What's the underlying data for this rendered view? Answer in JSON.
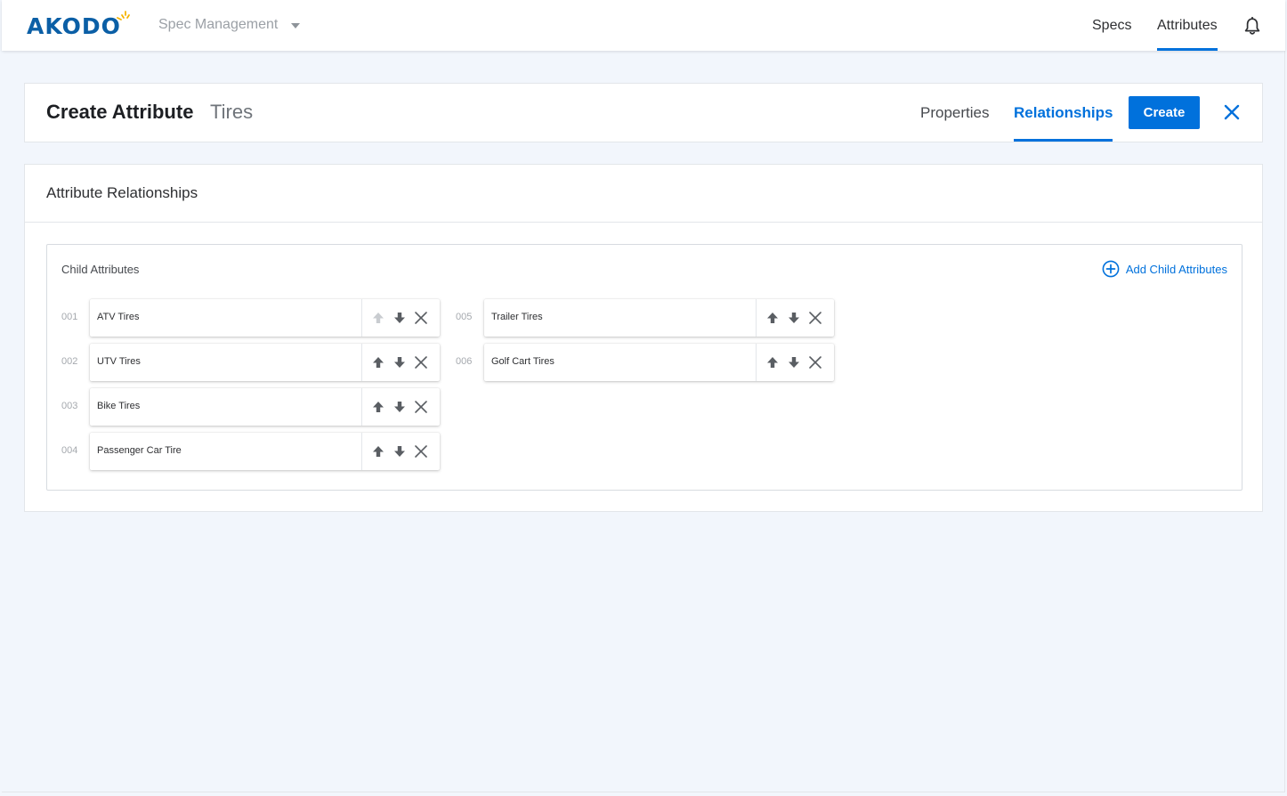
{
  "brand": {
    "logo_text": "AKODO",
    "accent": "#0071dc",
    "logo_color": "#0b5fa6",
    "sun_color": "#f5b400"
  },
  "topbar": {
    "app_switcher": "Spec Management",
    "nav": [
      {
        "label": "Specs",
        "active": false
      },
      {
        "label": "Attributes",
        "active": true
      }
    ],
    "notification_icon": "bell-icon"
  },
  "header": {
    "title": "Create Attribute",
    "subtitle": "Tires",
    "tabs": [
      {
        "label": "Properties",
        "active": false
      },
      {
        "label": "Relationships",
        "active": true
      }
    ],
    "create_label": "Create",
    "close_icon": "close-icon"
  },
  "relationships": {
    "title": "Attribute Relationships",
    "child_panel": {
      "title": "Child Attributes",
      "add_label": "Add Child Attributes",
      "items": [
        {
          "num": "001",
          "name": "ATV Tires",
          "up_enabled": false
        },
        {
          "num": "002",
          "name": "UTV Tires",
          "up_enabled": true
        },
        {
          "num": "003",
          "name": "Bike Tires",
          "up_enabled": true
        },
        {
          "num": "004",
          "name": "Passenger Car Tire",
          "up_enabled": true
        },
        {
          "num": "005",
          "name": "Trailer Tires",
          "up_enabled": true
        },
        {
          "num": "006",
          "name": "Golf Cart Tires",
          "up_enabled": true
        }
      ]
    }
  }
}
